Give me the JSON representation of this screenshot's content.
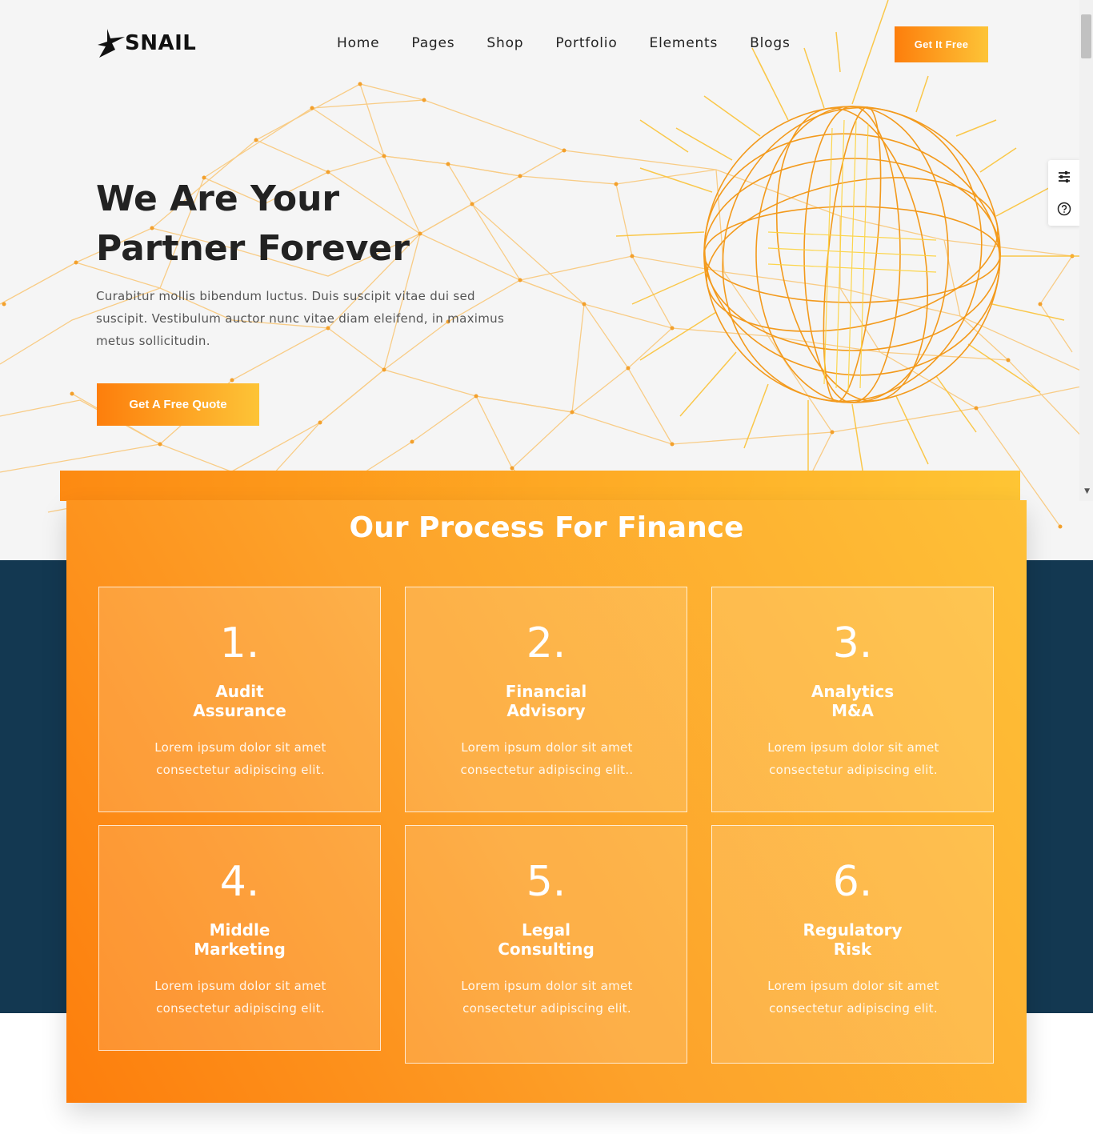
{
  "brand": {
    "name": "SNAIL"
  },
  "nav": {
    "items": [
      {
        "label": "Home"
      },
      {
        "label": "Pages"
      },
      {
        "label": "Shop"
      },
      {
        "label": "Portfolio"
      },
      {
        "label": "Elements"
      },
      {
        "label": "Blogs"
      }
    ],
    "cta_label": "Get It Free"
  },
  "hero": {
    "title_line1": "We Are Your",
    "title_line2": "Partner Forever",
    "description": "Curabitur mollis bibendum luctus. Duis suscipit vitae dui sed suscipit. Vestibulum auctor nunc vitae diam eleifend, in maximus metus sollicitudin.",
    "button_label": "Get A Free Quote"
  },
  "side_tools": {
    "icons": [
      "sliders-icon",
      "help-circle-icon"
    ]
  },
  "process": {
    "heading": "Our Process For Finance",
    "cards": [
      {
        "number": "1.",
        "title_line1": "Audit",
        "title_line2": "Assurance",
        "description": "Lorem ipsum dolor sit amet consectetur adipiscing elit."
      },
      {
        "number": "2.",
        "title_line1": "Financial",
        "title_line2": "Advisory",
        "description": "Lorem ipsum dolor sit amet consectetur adipiscing elit.."
      },
      {
        "number": "3.",
        "title_line1": "Analytics",
        "title_line2": "M&A",
        "description": "Lorem ipsum dolor sit amet consectetur adipiscing elit."
      },
      {
        "number": "4.",
        "title_line1": "Middle",
        "title_line2": "Marketing",
        "description": "Lorem ipsum dolor sit amet consectetur adipiscing elit."
      },
      {
        "number": "5.",
        "title_line1": "Legal",
        "title_line2": "Consulting",
        "description": "Lorem ipsum dolor sit amet consectetur adipiscing elit."
      },
      {
        "number": "6.",
        "title_line1": "Regulatory",
        "title_line2": "Risk",
        "description": "Lorem ipsum dolor sit amet consectetur adipiscing elit."
      }
    ]
  },
  "colors": {
    "accent_start": "#fd7e0c",
    "accent_end": "#fdc437",
    "navy": "#133851",
    "hero_bg": "#f5f5f5"
  }
}
